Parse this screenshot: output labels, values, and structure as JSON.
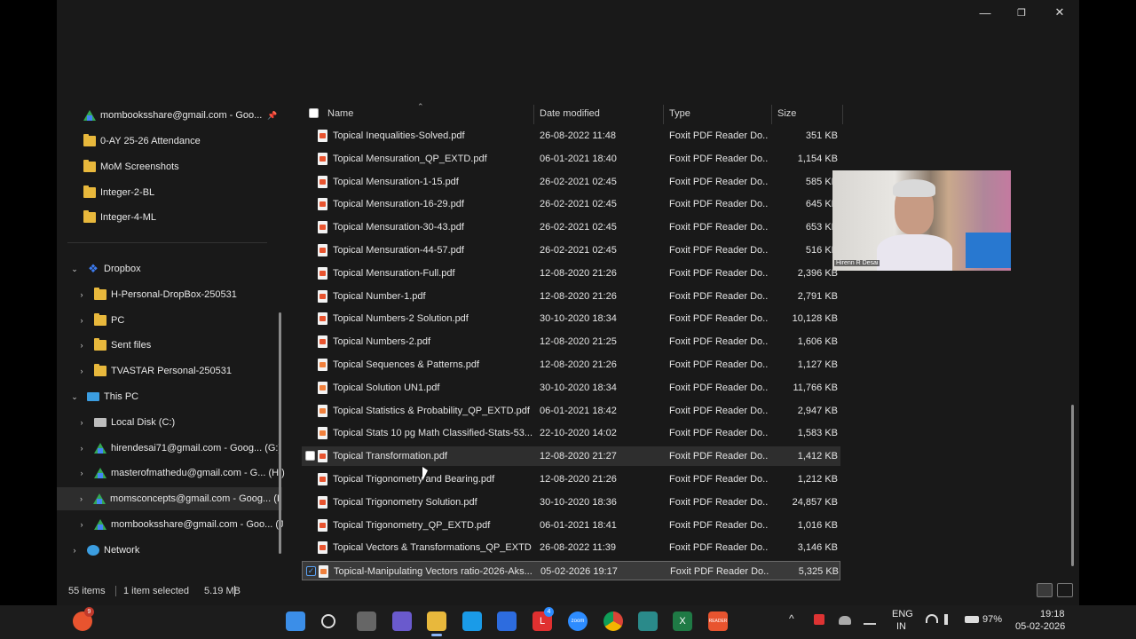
{
  "window": {
    "controls": {
      "minimize": "—",
      "restore": "❐",
      "close": "✕"
    }
  },
  "nav": {
    "items": [
      {
        "label": "mombooksshare@gmail.com - Goo...",
        "icon": "google-drive-icon",
        "pin": true
      },
      {
        "label": "0-AY 25-26 Attendance",
        "icon": "folder-icon"
      },
      {
        "label": "MoM Screenshots",
        "icon": "folder-icon"
      },
      {
        "label": "Integer-2-BL",
        "icon": "folder-icon"
      },
      {
        "label": "Integer-4-ML",
        "icon": "folder-icon"
      },
      {
        "label": "Dropbox",
        "icon": "dropbox-icon",
        "chevron": "⌄"
      },
      {
        "label": "H-Personal-DropBox-250531",
        "icon": "folder-icon",
        "chevron": "›"
      },
      {
        "label": "PC",
        "icon": "folder-icon",
        "chevron": "›"
      },
      {
        "label": "Sent files",
        "icon": "folder-icon",
        "chevron": "›"
      },
      {
        "label": "TVASTAR Personal-250531",
        "icon": "folder-icon",
        "chevron": "›"
      },
      {
        "label": "This PC",
        "icon": "this-pc-icon",
        "chevron": "⌄"
      },
      {
        "label": "Local Disk (C:)",
        "icon": "disk-icon",
        "chevron": "›"
      },
      {
        "label": "hirendesai71@gmail.com - Goog... (G:)",
        "icon": "google-drive-icon",
        "chevron": "›"
      },
      {
        "label": "masterofmathedu@gmail.com - G... (H:)",
        "icon": "google-drive-icon",
        "chevron": "›"
      },
      {
        "label": "momsconcepts@gmail.com - Goog... (I:",
        "icon": "google-drive-icon",
        "chevron": "›",
        "selected": true
      },
      {
        "label": "mombooksshare@gmail.com - Goo... (J",
        "icon": "google-drive-icon",
        "chevron": "›"
      },
      {
        "label": "Network",
        "icon": "network-icon",
        "chevron": "›"
      }
    ]
  },
  "columns": {
    "name": "Name",
    "date": "Date modified",
    "type": "Type",
    "size": "Size",
    "sort_arrow": "⌃"
  },
  "files": [
    {
      "name": "Topical Inequalities-Solved.pdf",
      "date": "26-08-2022 11:48",
      "type": "Foxit PDF Reader Do...",
      "size": "351 KB"
    },
    {
      "name": "Topical Mensuration_QP_EXTD.pdf",
      "date": "06-01-2021 18:40",
      "type": "Foxit PDF Reader Do...",
      "size": "1,154 KB"
    },
    {
      "name": "Topical Mensuration-1-15.pdf",
      "date": "26-02-2021 02:45",
      "type": "Foxit PDF Reader Do...",
      "size": "585 KB"
    },
    {
      "name": "Topical Mensuration-16-29.pdf",
      "date": "26-02-2021 02:45",
      "type": "Foxit PDF Reader Do...",
      "size": "645 KB"
    },
    {
      "name": "Topical Mensuration-30-43.pdf",
      "date": "26-02-2021 02:45",
      "type": "Foxit PDF Reader Do...",
      "size": "653 KB"
    },
    {
      "name": "Topical Mensuration-44-57.pdf",
      "date": "26-02-2021 02:45",
      "type": "Foxit PDF Reader Do...",
      "size": "516 KB"
    },
    {
      "name": "Topical Mensuration-Full.pdf",
      "date": "12-08-2020 21:26",
      "type": "Foxit PDF Reader Do...",
      "size": "2,396 KB"
    },
    {
      "name": "Topical Number-1.pdf",
      "date": "12-08-2020 21:26",
      "type": "Foxit PDF Reader Do...",
      "size": "2,791 KB"
    },
    {
      "name": "Topical Numbers-2 Solution.pdf",
      "date": "30-10-2020 18:34",
      "type": "Foxit PDF Reader Do...",
      "size": "10,128 KB"
    },
    {
      "name": "Topical Numbers-2.pdf",
      "date": "12-08-2020 21:25",
      "type": "Foxit PDF Reader Do...",
      "size": "1,606 KB"
    },
    {
      "name": "Topical Sequences & Patterns.pdf",
      "date": "12-08-2020 21:26",
      "type": "Foxit PDF Reader Do...",
      "size": "1,127 KB"
    },
    {
      "name": "Topical Solution UN1.pdf",
      "date": "30-10-2020 18:34",
      "type": "Foxit PDF Reader Do...",
      "size": "11,766 KB"
    },
    {
      "name": "Topical Statistics & Probability_QP_EXTD.pdf",
      "date": "06-01-2021 18:42",
      "type": "Foxit PDF Reader Do...",
      "size": "2,947 KB"
    },
    {
      "name": "Topical Stats 10 pg Math Classified-Stats-53...",
      "date": "22-10-2020 14:02",
      "type": "Foxit PDF Reader Do...",
      "size": "1,583 KB"
    },
    {
      "name": "Topical Transformation.pdf",
      "date": "12-08-2020 21:27",
      "type": "Foxit PDF Reader Do...",
      "size": "1,412 KB",
      "hover": true
    },
    {
      "name": "Topical Trigonometry and Bearing.pdf",
      "date": "12-08-2020 21:26",
      "type": "Foxit PDF Reader Do...",
      "size": "1,212 KB"
    },
    {
      "name": "Topical Trigonometry Solution.pdf",
      "date": "30-10-2020 18:36",
      "type": "Foxit PDF Reader Do...",
      "size": "24,857 KB"
    },
    {
      "name": "Topical Trigonometry_QP_EXTD.pdf",
      "date": "06-01-2021 18:41",
      "type": "Foxit PDF Reader Do...",
      "size": "1,016 KB"
    },
    {
      "name": "Topical Vectors & Transformations_QP_EXTD ...",
      "date": "26-08-2022 11:39",
      "type": "Foxit PDF Reader Do...",
      "size": "3,146 KB"
    },
    {
      "name": "Topical-Manipulating Vectors ratio-2026-Aks...",
      "date": "05-02-2026 19:17",
      "type": "Foxit PDF Reader Do...",
      "size": "5,325 KB",
      "selected": true
    }
  ],
  "status": {
    "count": "55 items",
    "selected": "1 item selected",
    "size": "5.19 MB"
  },
  "webcam": {
    "name": "Hirenn R Desai"
  },
  "taskbar": {
    "apps": [
      {
        "name": "copilot-app-icon",
        "badge": "9"
      },
      {
        "name": "start-icon"
      },
      {
        "name": "search-icon"
      },
      {
        "name": "task-view-icon"
      },
      {
        "name": "copilot-icon"
      },
      {
        "name": "file-explorer-icon",
        "active": true
      },
      {
        "name": "edge-icon"
      },
      {
        "name": "store-icon"
      },
      {
        "name": "l-app-icon",
        "label": "L",
        "badge": "4"
      },
      {
        "name": "zoom-icon",
        "label": "zoom"
      },
      {
        "name": "chrome-icon"
      },
      {
        "name": "c-app-icon"
      },
      {
        "name": "excel-icon",
        "label": "X"
      },
      {
        "name": "reader-icon",
        "label": "READER"
      }
    ],
    "tray": {
      "chevron": "^",
      "lang_top": "ENG",
      "lang_bottom": "IN",
      "battery": "97%",
      "time": "19:18",
      "date": "05-02-2026"
    }
  },
  "colors": {
    "accent": "#5aa0f0",
    "background": "#191919",
    "taskbar": "#1c1c1c"
  }
}
